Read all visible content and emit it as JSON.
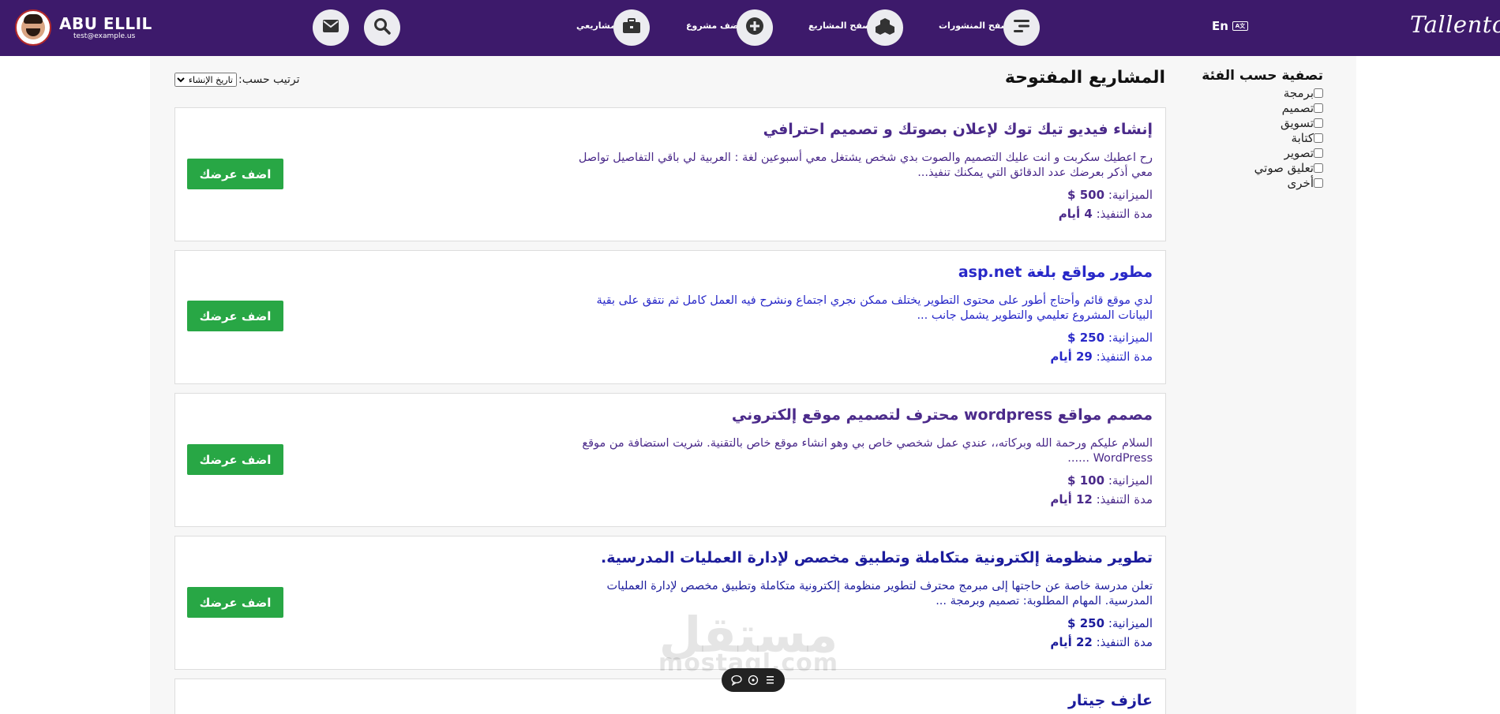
{
  "header": {
    "brand": "Tallento",
    "lang_label": "En",
    "user": {
      "name": "ABU ELLIL",
      "email": "test@example.us"
    },
    "nav": [
      {
        "label": "تصفح المنشورات",
        "icon": "list-icon"
      },
      {
        "label": "تصفح المشاريع",
        "icon": "cubes-icon"
      },
      {
        "label": "أضف مشروع",
        "icon": "plus-icon"
      },
      {
        "label": "مشاريعي",
        "icon": "briefcase-icon"
      }
    ],
    "accent": "#3d1a6b"
  },
  "main": {
    "title": "المشاريع المفتوحة",
    "sort": {
      "label": "ترتيب حسب:",
      "selected": "تاريخ الإنشاء"
    }
  },
  "filter": {
    "title": "تصفية حسب الفئة",
    "items": [
      "برمجة",
      "تصميم",
      "تسويق",
      "كتابة",
      "تصوير",
      "تعليق صوتي",
      "أخرى"
    ]
  },
  "projects": [
    {
      "title": "إنشاء فيديو تيك توك لإعلان بصوتك و تصميم احترافي",
      "description": "رح اعطيك سكربت و انت عليك التصميم والصوت بدي شخص يشتغل معي أسبوعين لغة : العربية لي باقي التفاصيل تواصل معي أذكر بعرضك عدد الدقائق التي يمكنك تنفيذ...",
      "budget_label": "الميزانية:",
      "budget": "500 $",
      "duration_label": "مدة التنفيذ:",
      "duration": "4 أيام",
      "button": "اضف عرضك"
    },
    {
      "title": "مطور مواقع بلغة asp.net",
      "description": "لدي موقع قائم وأحتاج أطور على محتوى التطوير يختلف ممكن نجري اجتماع ونشرح فيه العمل كامل ثم نتفق على بقية البيانات المشروع تعليمي والتطوير يشمل جانب ...",
      "budget_label": "الميزانية:",
      "budget": "250 $",
      "duration_label": "مدة التنفيذ:",
      "duration": "29 أيام",
      "button": "اضف عرضك"
    },
    {
      "title": "مصمم مواقع wordpress محترف لتصميم موقع إلكتروني",
      "description": "السلام عليكم ورحمة الله وبركاته،، عندي عمل شخصي خاص بي وهو انشاء موقع خاص بالتقنية. شريت استضافة من موقع WordPress ......",
      "budget_label": "الميزانية:",
      "budget": "100 $",
      "duration_label": "مدة التنفيذ:",
      "duration": "12 أيام",
      "button": "اضف عرضك"
    },
    {
      "title": "تطوير منظومة إلكترونية متكاملة وتطبيق مخصص لإدارة العمليات المدرسية.",
      "description": "تعلن مدرسة خاصة عن حاجتها إلى مبرمج محترف لتطوير منظومة إلكترونية متكاملة وتطبيق مخصص لإدارة العمليات المدرسية. المهام المطلوبة: تصميم وبرمجة ...",
      "budget_label": "الميزانية:",
      "budget": "250 $",
      "duration_label": "مدة التنفيذ:",
      "duration": "22 أيام",
      "button": "اضف عرضك"
    },
    {
      "title": "عازف جيتار"
    }
  ],
  "watermark": {
    "arabic": "مستقل",
    "latin": "mostaql.com"
  }
}
